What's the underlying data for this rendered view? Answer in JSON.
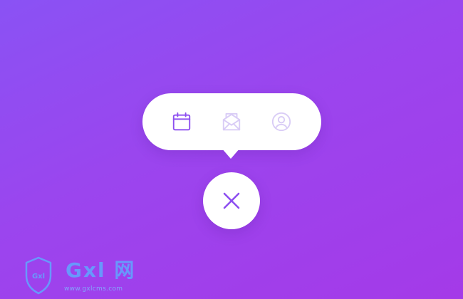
{
  "menu": {
    "items": [
      {
        "icon": "calendar-icon",
        "state": "active",
        "color": "#8d4ff0"
      },
      {
        "icon": "mail-open-icon",
        "state": "inactive",
        "color": "#d9ccf6"
      },
      {
        "icon": "user-profile-icon",
        "state": "inactive",
        "color": "#d9ccf6"
      }
    ]
  },
  "close_button": {
    "icon": "close-icon",
    "color": "#8d4ff0"
  },
  "watermark": {
    "badge_text": "Gxl",
    "brand_text": "Gxl 网",
    "url_text": "www.gxlcms.com"
  },
  "colors": {
    "background_start": "#8a52f4",
    "background_end": "#a43ae8",
    "surface": "#ffffff",
    "accent": "#8d4ff0",
    "watermark": "#5fa8ff"
  }
}
